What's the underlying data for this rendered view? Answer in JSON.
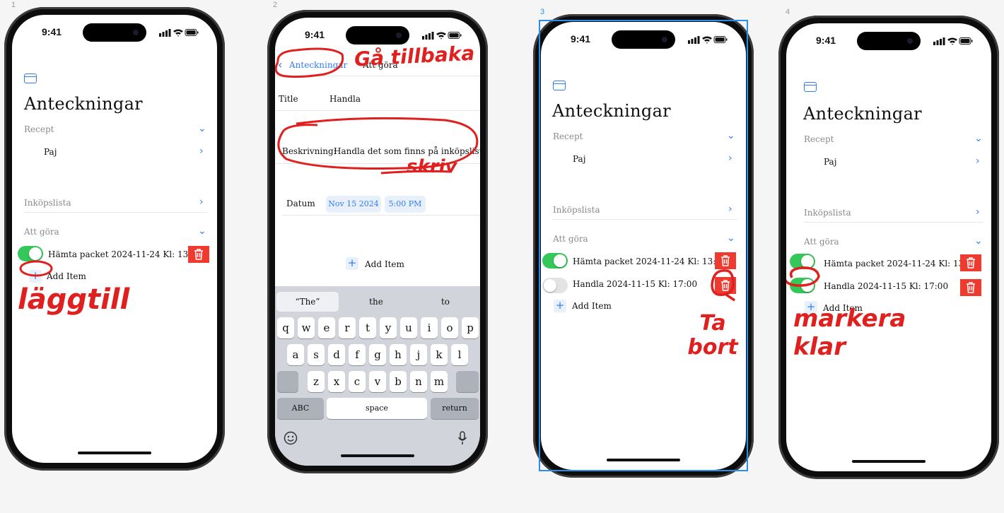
{
  "frames": [
    {
      "number": "1",
      "time": "9:41",
      "title": "Anteckningar",
      "sections": {
        "recept": {
          "label": "Recept",
          "items": [
            "Paj"
          ]
        },
        "inkopslista": {
          "label": "Inköpslista"
        },
        "att_gora": {
          "label": "Att göra"
        }
      },
      "todos": [
        {
          "text": "Hämta packet 2024-11-24 Kl: 13:00",
          "done": true
        }
      ],
      "add_item": "Add Item",
      "annotation": "läggtill"
    },
    {
      "number": "2",
      "time": "9:41",
      "nav": {
        "back_label": "Anteckningar",
        "title": "Att göra"
      },
      "form": {
        "title_label": "Title",
        "title_value": "Handla",
        "desc_label": "Beskrivning:",
        "desc_value": "Handla det som finns på inköpslistan",
        "date_label": "Datum",
        "date_value": "Nov 15 2024",
        "time_value": "5:00 PM"
      },
      "add_item": "Add Item",
      "keyboard": {
        "suggestions": [
          "“The”",
          "the",
          "to"
        ],
        "row1": [
          "q",
          "w",
          "e",
          "r",
          "t",
          "y",
          "u",
          "i",
          "o",
          "p"
        ],
        "row2": [
          "a",
          "s",
          "d",
          "f",
          "g",
          "h",
          "j",
          "k",
          "l"
        ],
        "row3": [
          "z",
          "x",
          "c",
          "v",
          "b",
          "n",
          "m"
        ],
        "abc": "ABC",
        "space": "space",
        "return": "return"
      },
      "annotations": [
        "Gå tillbaka",
        "skriv"
      ]
    },
    {
      "number": "3",
      "time": "9:41",
      "title": "Anteckningar",
      "sections": {
        "recept": {
          "label": "Recept",
          "items": [
            "Paj"
          ]
        },
        "inkopslista": {
          "label": "Inköpslista"
        },
        "att_gora": {
          "label": "Att göra"
        }
      },
      "todos": [
        {
          "text": "Hämta packet 2024-11-24 Kl: 13:00",
          "done": true
        },
        {
          "text": "Handla 2024-11-15 Kl: 17:00",
          "done": false
        }
      ],
      "add_item": "Add Item",
      "annotation": "Ta bort"
    },
    {
      "number": "4",
      "time": "9:41",
      "title": "Anteckningar",
      "sections": {
        "recept": {
          "label": "Recept",
          "items": [
            "Paj"
          ]
        },
        "inkopslista": {
          "label": "Inköpslista"
        },
        "att_gora": {
          "label": "Att göra"
        }
      },
      "todos": [
        {
          "text": "Hämta packet 2024-11-24 Kl: 13:00",
          "done": true
        },
        {
          "text": "Handla 2024-11-15 Kl: 17:00",
          "done": true
        }
      ],
      "add_item": "Add Item",
      "annotation": "markera klar"
    }
  ],
  "colors": {
    "accent": "#2f7cf6",
    "toggle_on": "#34c759",
    "delete": "#ef3a2f",
    "annotation": "#e0201e",
    "selection": "#2a8ef0"
  }
}
